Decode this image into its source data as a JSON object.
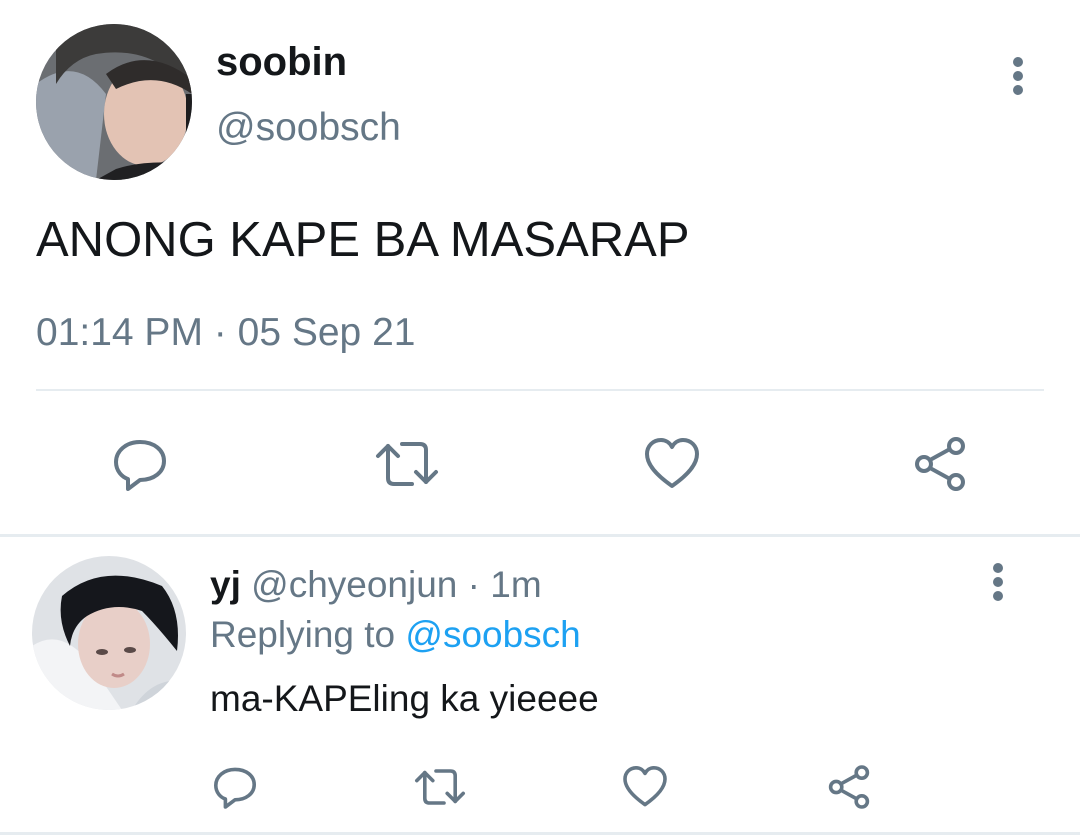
{
  "main_tweet": {
    "display_name": "soobin",
    "handle": "@soobsch",
    "text": "ANONG KAPE BA MASARAP",
    "time": "01:14 PM",
    "separator": "·",
    "date": "05 Sep 21",
    "avatar_icon": "user-avatar-photo",
    "menu_icon": "more-vertical-icon",
    "actions": [
      "reply-icon",
      "retweet-icon",
      "like-icon",
      "share-icon"
    ]
  },
  "reply_tweet": {
    "display_name": "yj",
    "handle": "@chyeonjun",
    "separator": "·",
    "age": "1m",
    "replying_to_label": "Replying to",
    "replying_to_handle": "@soobsch",
    "text": "ma-KAPEling ka yieeee",
    "avatar_icon": "user-avatar-photo",
    "menu_icon": "more-vertical-icon",
    "actions": [
      "reply-icon",
      "retweet-icon",
      "like-icon",
      "share-icon"
    ]
  },
  "colors": {
    "text_primary": "#14171a",
    "text_secondary": "#657786",
    "link": "#1da1f2",
    "divider": "#e6ecf0",
    "icon": "#657786"
  }
}
